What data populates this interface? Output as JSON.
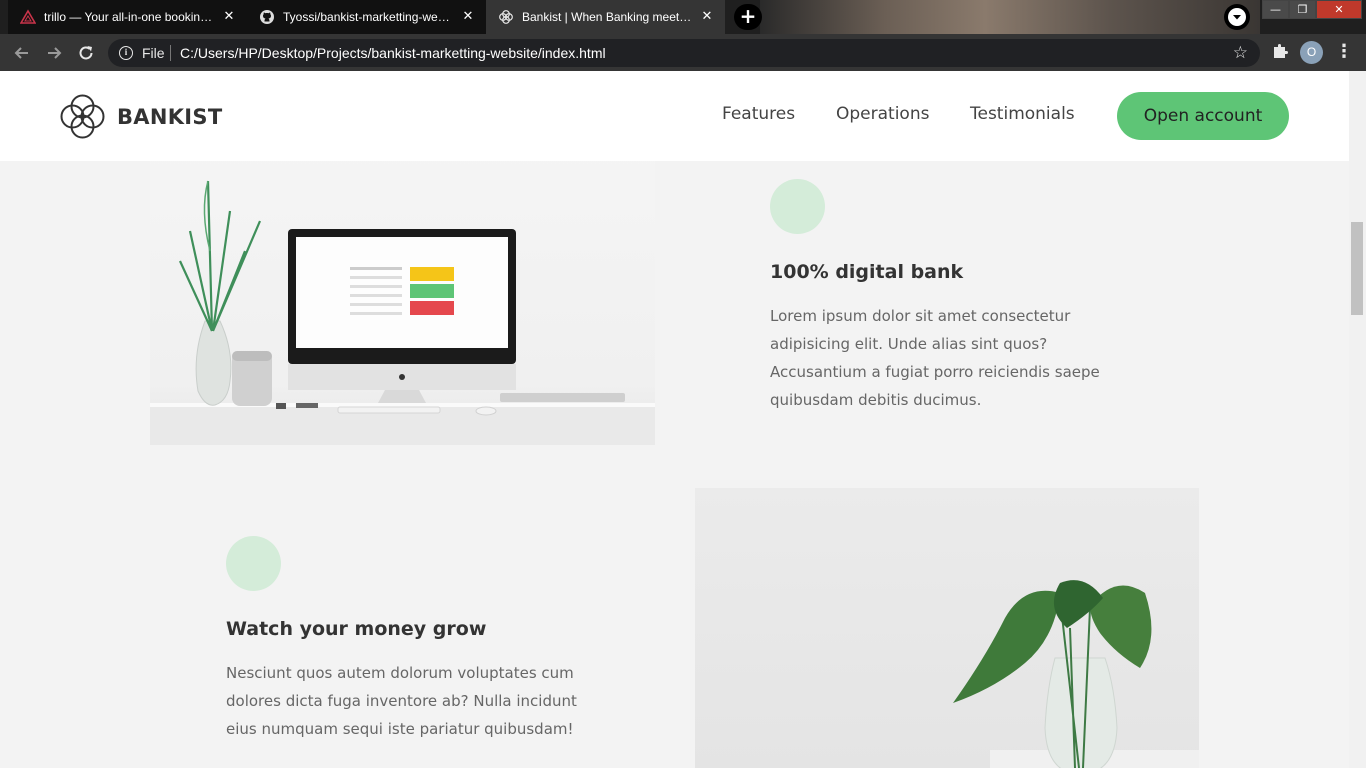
{
  "browser": {
    "tabs": [
      {
        "title": "trillo — Your all-in-one booking app",
        "icon": "triangle-logo-icon",
        "active": false
      },
      {
        "title": "Tyossi/bankist-marketting-website",
        "icon": "github-icon",
        "active": false
      },
      {
        "title": "Bankist | When Banking meets Minimalist",
        "icon": "bankist-logo-icon",
        "active": true
      }
    ],
    "close_glyph": "✕",
    "new_tab_glyph": "+",
    "window": {
      "minimize": "—",
      "maximize": "❐",
      "close": "✕"
    },
    "address": {
      "scheme_label": "File",
      "url": "C:/Users/HP/Desktop/Projects/bankist-marketting-website/index.html"
    },
    "profile_initial": "O"
  },
  "site": {
    "logo_text": "BANKIST",
    "nav": {
      "features": "Features",
      "operations": "Operations",
      "testimonials": "Testimonials",
      "cta": "Open account"
    },
    "features": [
      {
        "title": "100% digital bank",
        "text": "Lorem ipsum dolor sit amet consectetur adipisicing elit. Unde alias sint quos? Accusantium a fugiat porro reiciendis saepe quibusdam debitis ducimus."
      },
      {
        "title": "Watch your money grow",
        "text": "Nesciunt quos autem dolorum voluptates cum dolores dicta fuga inventore ab? Nulla incidunt eius numquam sequi iste pariatur quibusdam!"
      }
    ]
  },
  "colors": {
    "accent_green": "#5ec576",
    "icon_green_light": "#d4ecd9",
    "page_bg": "#f3f3f3"
  }
}
